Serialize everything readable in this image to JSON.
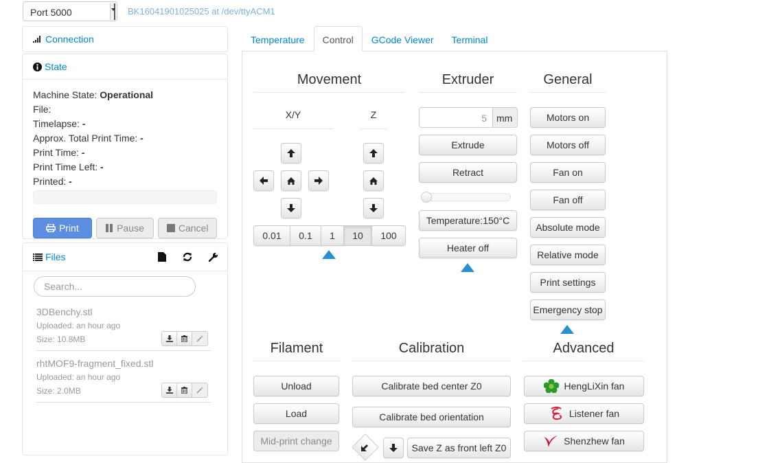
{
  "topbar": {
    "port_select": "Port 5000",
    "printer_id": "BK16041901025025 at /dev/ttyACM1"
  },
  "sidebar": {
    "connection": {
      "title": "Connection",
      "icon": "signal-icon"
    },
    "state": {
      "title": "State",
      "icon": "info-icon",
      "machine_state_label": "Machine State:",
      "machine_state_value": "Operational",
      "file_label": "File:",
      "file_value": "",
      "timelapse_label": "Timelapse:",
      "timelapse_value": "-",
      "approx_total_label": "Approx. Total Print Time:",
      "approx_total_value": "-",
      "print_time_label": "Print Time:",
      "print_time_value": "-",
      "print_time_left_label": "Print Time Left:",
      "print_time_left_value": "-",
      "printed_label": "Printed:",
      "printed_value": "-",
      "progress_percent": 0,
      "buttons": {
        "print": "Print",
        "pause": "Pause",
        "cancel": "Cancel"
      }
    },
    "files": {
      "title": "Files",
      "search_placeholder": "Search...",
      "items": [
        {
          "name": "3DBenchy.stl",
          "uploaded": "Uploaded: an hour ago",
          "size": "Size: 10.8MB"
        },
        {
          "name": "rhtMOF9-fragment_fixed.stl",
          "uploaded": "Uploaded: an hour ago",
          "size": "Size: 2.0MB"
        }
      ]
    }
  },
  "tabs": [
    {
      "label": "Temperature",
      "active": false
    },
    {
      "label": "Control",
      "active": true
    },
    {
      "label": "GCode Viewer",
      "active": false
    },
    {
      "label": "Terminal",
      "active": false
    }
  ],
  "control": {
    "movement": {
      "title": "Movement",
      "xy_label": "X/Y",
      "z_label": "Z",
      "distances": [
        "0.01",
        "0.1",
        "1",
        "10",
        "100"
      ],
      "selected_distance": "10"
    },
    "extruder": {
      "title": "Extruder",
      "amount_value": "5",
      "amount_unit": "mm",
      "extrude": "Extrude",
      "retract": "Retract",
      "slider_value": 0,
      "temperature": "Temperature:150°C",
      "heater_off": "Heater off"
    },
    "general": {
      "title": "General",
      "buttons": [
        "Motors on",
        "Motors off",
        "Fan on",
        "Fan off",
        "Absolute mode",
        "Relative mode",
        "Print settings",
        "Emergency stop"
      ]
    },
    "filament": {
      "title": "Filament",
      "unload": "Unload",
      "load": "Load",
      "mid_print_change": "Mid-print change"
    },
    "calibration": {
      "title": "Calibration",
      "bed_center": "Calibrate bed center Z0",
      "bed_orientation": "Calibrate bed orientation",
      "save_z": "Save Z as front left Z0"
    },
    "advanced": {
      "title": "Advanced",
      "fans": [
        "HengLiXin fan",
        "Listener fan",
        "Shenzhew fan"
      ]
    }
  },
  "colors": {
    "link": "#0088cc",
    "primary_button": "#5b8ee0",
    "triangle": "#2a8fd0"
  }
}
